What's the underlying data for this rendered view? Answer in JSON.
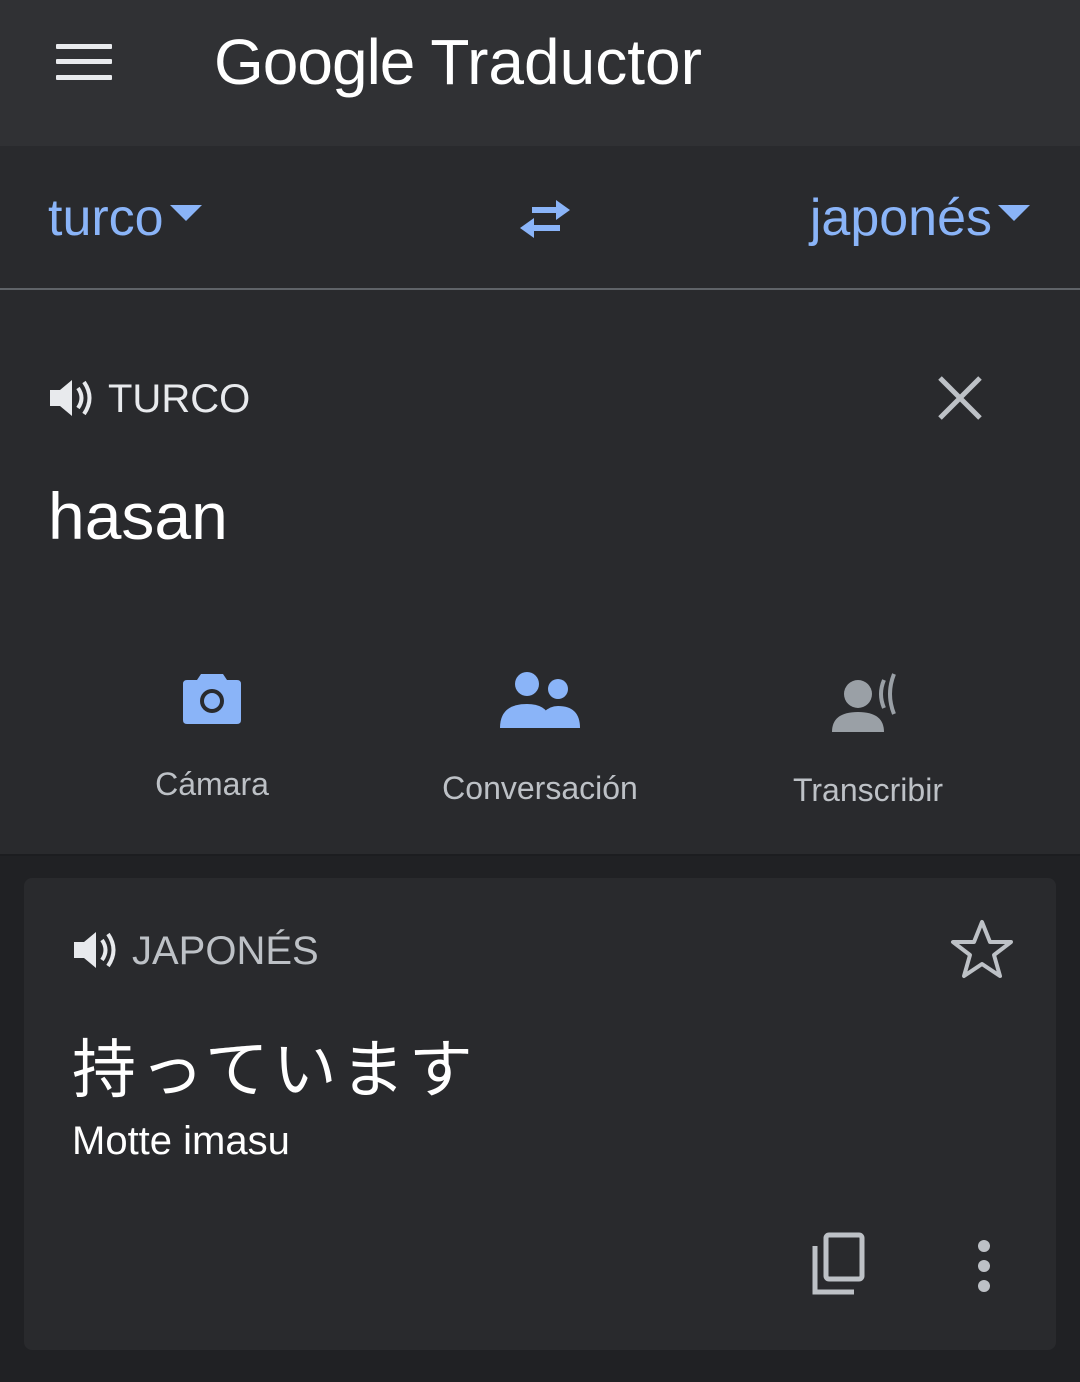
{
  "app": {
    "brand": "Google",
    "title": "Traductor"
  },
  "languages": {
    "source": "turco",
    "target": "japonés"
  },
  "input": {
    "label": "TURCO",
    "text": "hasan"
  },
  "tools": [
    {
      "label": "Cámara",
      "icon": "camera-icon",
      "color": "#8ab4f8"
    },
    {
      "label": "Conversación",
      "icon": "conversation-icon",
      "color": "#8ab4f8"
    },
    {
      "label": "Transcribir",
      "icon": "transcribe-icon",
      "color": "#9aa0a6"
    }
  ],
  "result": {
    "label": "JAPONÉS",
    "text": "持っています",
    "romanization": "Motte imasu"
  },
  "colors": {
    "accent": "#8ab4f8",
    "background": "#202124",
    "surface": "#292a2d",
    "appbar": "#303134"
  }
}
